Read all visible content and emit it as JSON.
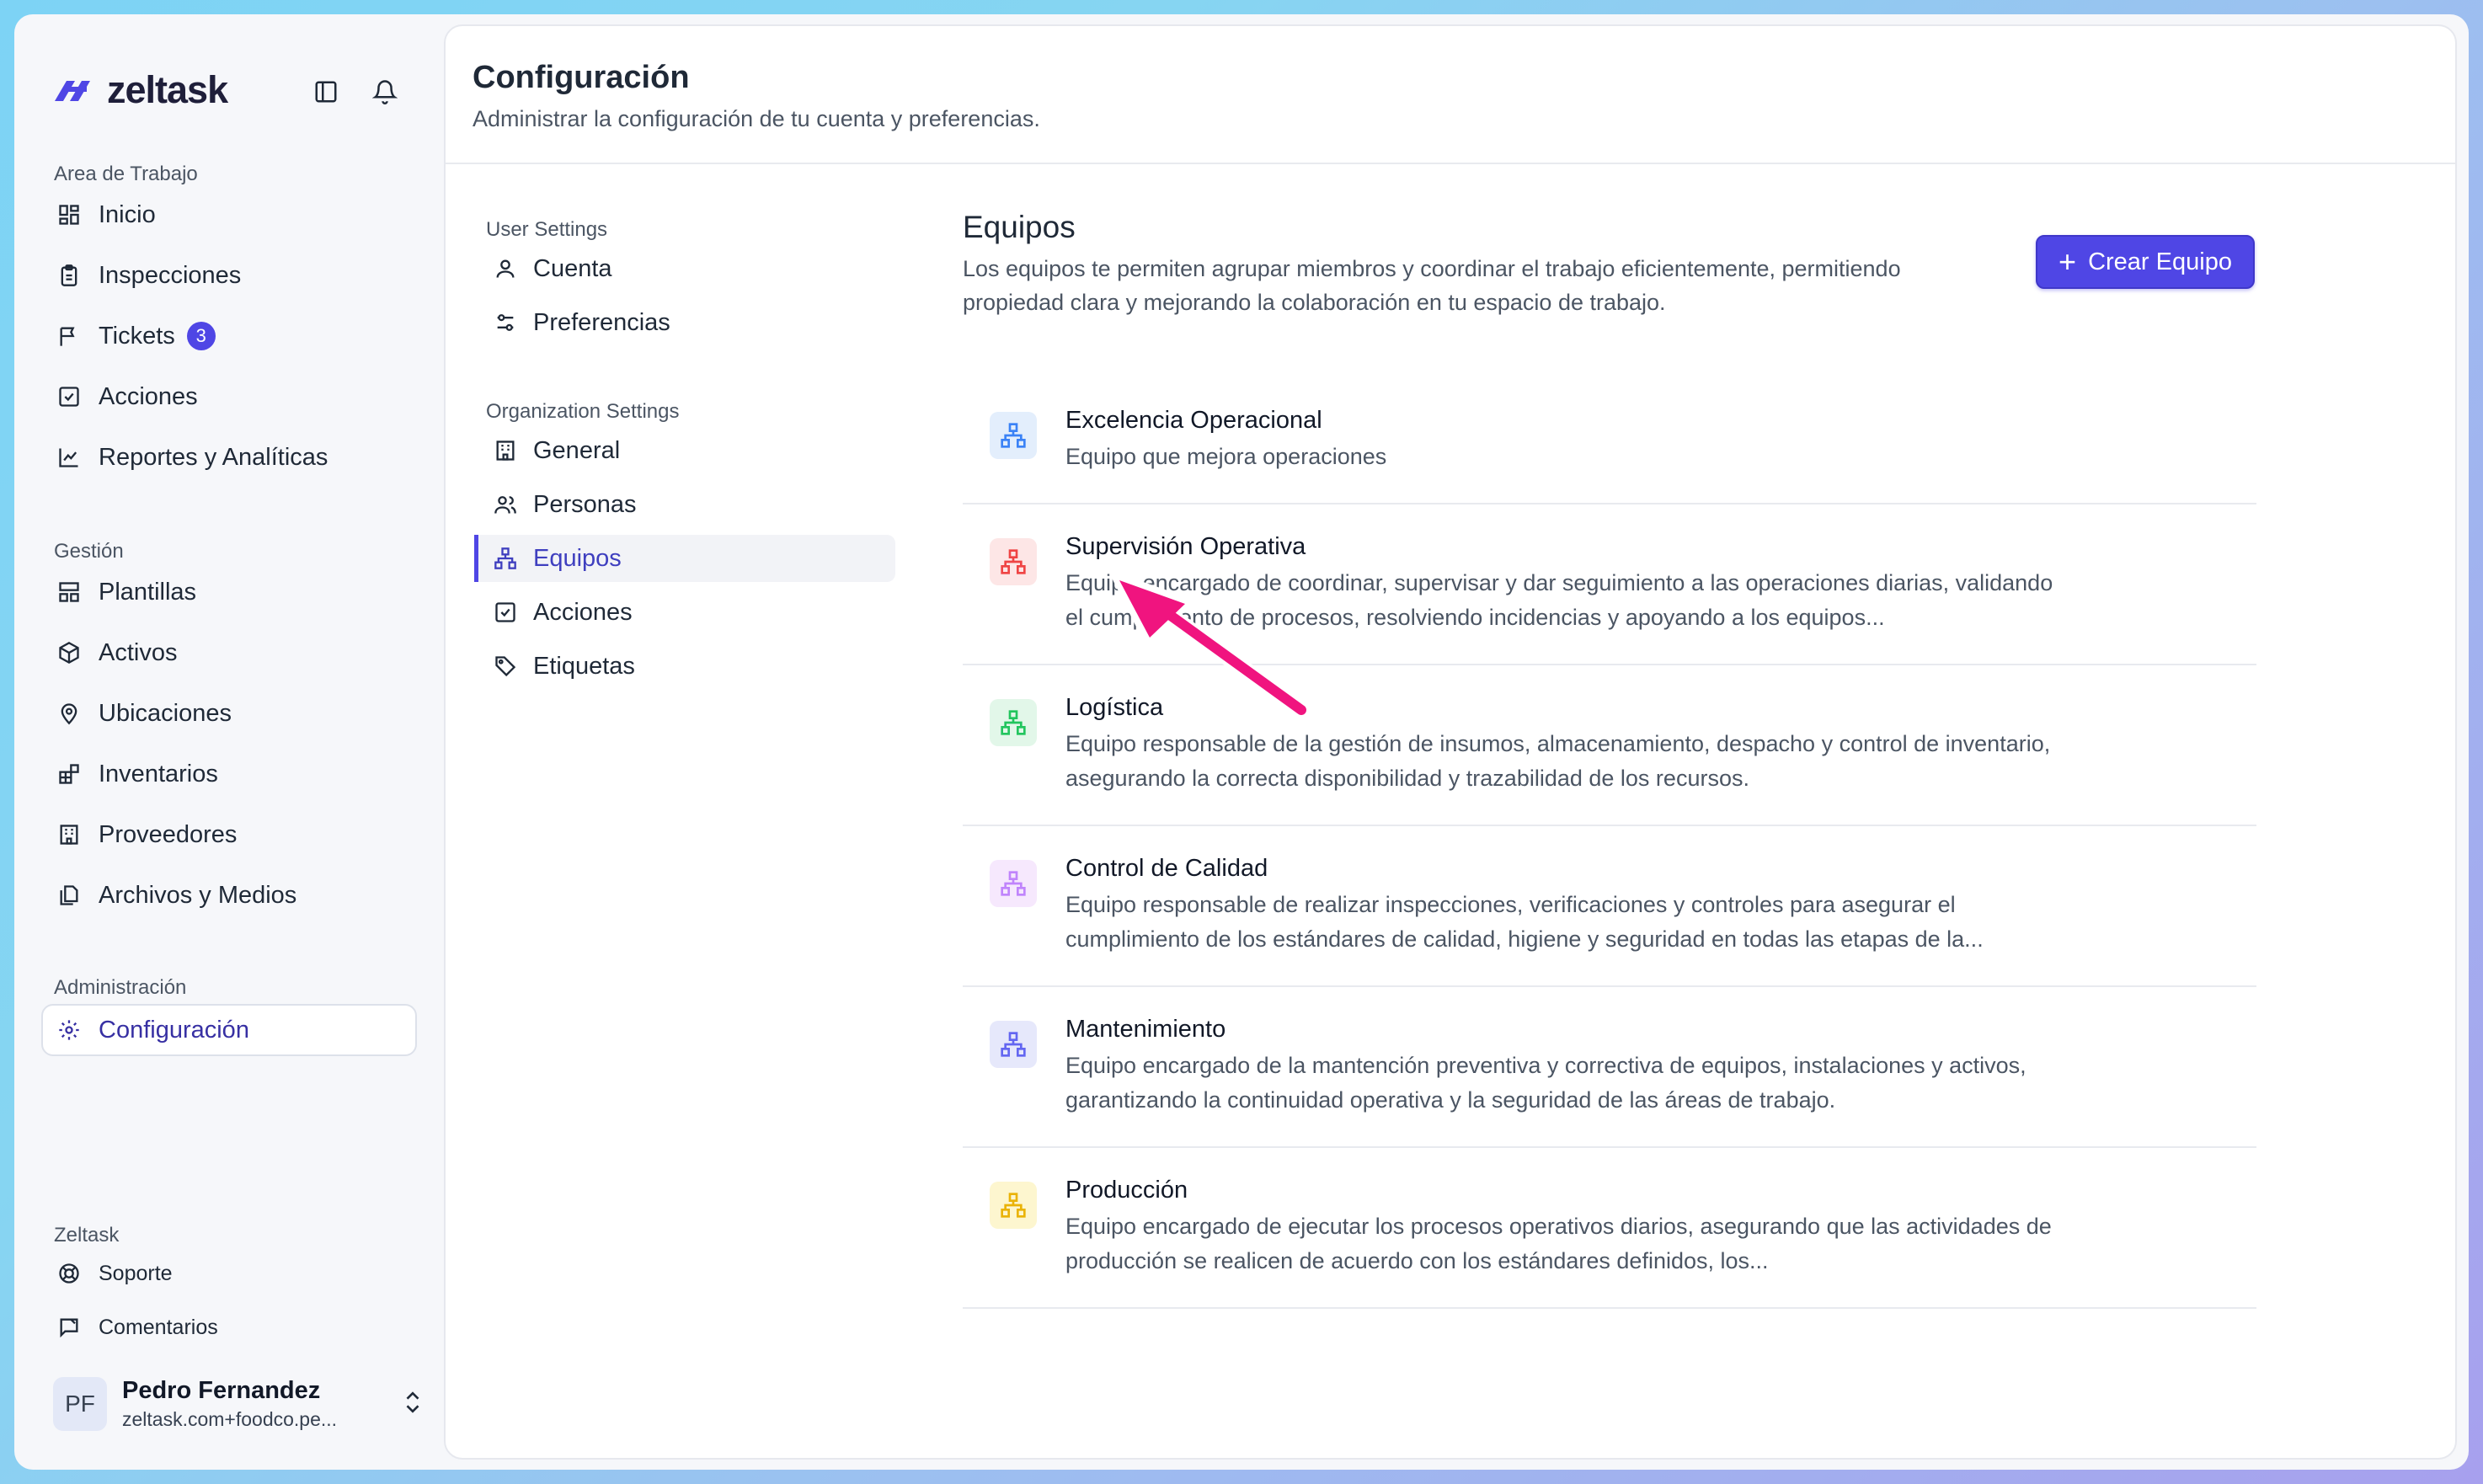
{
  "app": {
    "name": "zeltask"
  },
  "sidebar": {
    "sections": [
      {
        "title": "Area de Trabajo"
      },
      {
        "title": "Gestión"
      },
      {
        "title": "Administración"
      },
      {
        "title": "Zeltask"
      }
    ],
    "workspace_items": [
      {
        "label": "Inicio",
        "icon": "grid-icon"
      },
      {
        "label": "Inspecciones",
        "icon": "clipboard-icon"
      },
      {
        "label": "Tickets",
        "icon": "flag-icon",
        "badge": "3"
      },
      {
        "label": "Acciones",
        "icon": "checkbox-icon"
      },
      {
        "label": "Reportes y Analíticas",
        "icon": "chart-icon"
      }
    ],
    "management_items": [
      {
        "label": "Plantillas",
        "icon": "layout-icon"
      },
      {
        "label": "Activos",
        "icon": "box-icon"
      },
      {
        "label": "Ubicaciones",
        "icon": "map-pin-icon"
      },
      {
        "label": "Inventarios",
        "icon": "blocks-icon"
      },
      {
        "label": "Proveedores",
        "icon": "building-icon"
      },
      {
        "label": "Archivos y Medios",
        "icon": "files-icon"
      }
    ],
    "admin_items": [
      {
        "label": "Configuración",
        "icon": "gear-icon",
        "active": true
      }
    ],
    "zeltask_items": [
      {
        "label": "Soporte",
        "icon": "lifebuoy-icon"
      },
      {
        "label": "Comentarios",
        "icon": "feedback-icon"
      }
    ],
    "user": {
      "initials": "PF",
      "name": "Pedro Fernandez",
      "email": "zeltask.com+foodco.pe..."
    }
  },
  "header": {
    "title": "Configuración",
    "subtitle": "Administrar la configuración de tu cuenta y preferencias."
  },
  "settings_nav": {
    "user_title": "User Settings",
    "user_items": [
      {
        "label": "Cuenta",
        "icon": "user-icon"
      },
      {
        "label": "Preferencias",
        "icon": "sliders-icon"
      }
    ],
    "org_title": "Organization Settings",
    "org_items": [
      {
        "label": "General",
        "icon": "building-icon"
      },
      {
        "label": "Personas",
        "icon": "users-icon"
      },
      {
        "label": "Equipos",
        "icon": "network-icon",
        "active": true
      },
      {
        "label": "Acciones",
        "icon": "checkbox-icon"
      },
      {
        "label": "Etiquetas",
        "icon": "tag-icon"
      }
    ]
  },
  "content": {
    "title": "Equipos",
    "description": "Los equipos te permiten agrupar miembros y coordinar el trabajo eficientemente, permitiendo propiedad clara y mejorando la colaboración en tu espacio de trabajo.",
    "create_button": "Crear Equipo",
    "teams": [
      {
        "name": "Excelencia Operacional",
        "description": "Equipo que mejora operaciones",
        "color": "#3b82f6",
        "bg": "#e3eefc"
      },
      {
        "name": "Supervisión Operativa",
        "description": "Equipo encargado de coordinar, supervisar y dar seguimiento a las operaciones diarias, validando el cumplimiento de procesos, resolviendo incidencias y apoyando a los equipos...",
        "color": "#ef4444",
        "bg": "#fde6e6"
      },
      {
        "name": "Logística",
        "description": "Equipo responsable de la gestión de insumos, almacenamiento, despacho y control de inventario, asegurando la correcta disponibilidad y trazabilidad de los recursos.",
        "color": "#22c55e",
        "bg": "#e2f7e9"
      },
      {
        "name": "Control de Calidad",
        "description": "Equipo responsable de realizar inspecciones, verificaciones y controles para asegurar el cumplimiento de los estándares de calidad, higiene y seguridad en todas las etapas de la...",
        "color": "#c084fc",
        "bg": "#f6e8fd"
      },
      {
        "name": "Mantenimiento",
        "description": "Equipo encargado de la mantención preventiva y correctiva de equipos, instalaciones y activos, garantizando la continuidad operativa y la seguridad de las áreas de trabajo.",
        "color": "#6366f1",
        "bg": "#e6e8fb"
      },
      {
        "name": "Producción",
        "description": "Equipo encargado de ejecutar los procesos operativos diarios, asegurando que las actividades de producción se realicen de acuerdo con los estándares definidos, los...",
        "color": "#eab308",
        "bg": "#fdf6cf"
      }
    ]
  },
  "annotation": {
    "arrow_color": "#f0147f"
  }
}
